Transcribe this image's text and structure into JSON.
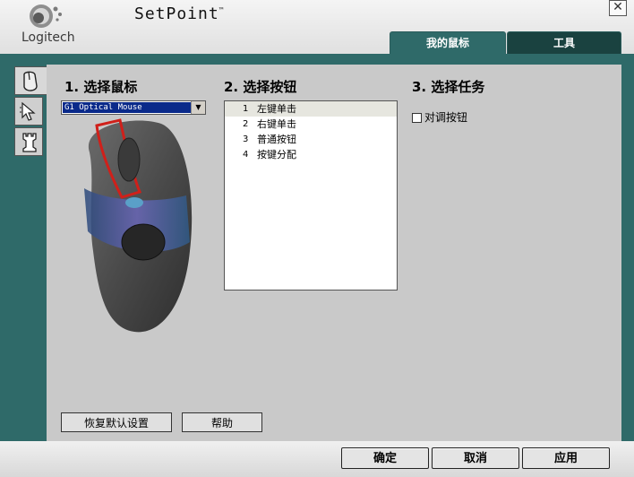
{
  "app": {
    "logo_text": "Logitech",
    "title": "SetPoint",
    "trademark": "™"
  },
  "window": {
    "close_glyph": "✕"
  },
  "tabs": [
    {
      "label": "我的鼠标",
      "active": true
    },
    {
      "label": "工具",
      "active": false
    }
  ],
  "rail": {
    "items": [
      {
        "icon": "mouse-icon",
        "active": true
      },
      {
        "icon": "pointer-icon",
        "active": false
      },
      {
        "icon": "chess-rook-icon",
        "active": false
      }
    ]
  },
  "sections": {
    "select_mouse": {
      "title": "1. 选择鼠标",
      "selected": "G1 Optical Mouse",
      "dropdown_glyph": "▼"
    },
    "select_button": {
      "title": "2. 选择按钮",
      "items": [
        {
          "num": "1",
          "label": "左键单击",
          "selected": true
        },
        {
          "num": "2",
          "label": "右键单击",
          "selected": false
        },
        {
          "num": "3",
          "label": "普通按钮",
          "selected": false
        },
        {
          "num": "4",
          "label": "按键分配",
          "selected": false
        }
      ]
    },
    "select_task": {
      "title": "3. 选择任务",
      "checkbox_label": "对调按钮",
      "checked": false
    }
  },
  "panel_buttons": {
    "restore_defaults": "恢复默认设置",
    "help": "帮助"
  },
  "footer_buttons": {
    "ok": "确定",
    "cancel": "取消",
    "apply": "应用"
  },
  "colors": {
    "accent_teal": "#2f6a69",
    "dark_teal": "#1a4240",
    "selection_blue": "#0a2a8a",
    "highlight_red": "#d0201a"
  }
}
